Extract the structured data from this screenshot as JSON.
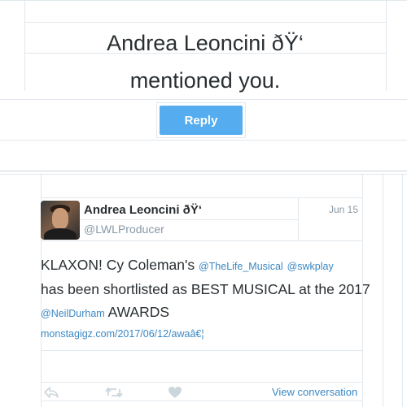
{
  "notification": {
    "line1": "Andrea Leoncini ðŸ‘",
    "line2": "mentioned you.",
    "reply_label": "Reply"
  },
  "tweet": {
    "author_name": "Andrea Leoncini ðŸ‘",
    "author_handle": "@LWLProducer",
    "date": "Jun 15",
    "text_1": "KLAXON! Cy Coleman's ",
    "mention_1": "@TheLife_Musical",
    "mention_2": "@swkplay",
    "text_2": "has been shortlisted as BEST MUSICAL at the 2017 ",
    "mention_3": "@NeilDurham",
    "text_3": " AWARDS",
    "link": "monstagigz.com/2017/06/12/awaâ€¦",
    "view_conversation": "View conversation"
  },
  "icons": {
    "reply": "reply-icon",
    "retweet": "retweet-icon",
    "like": "heart-icon"
  },
  "colors": {
    "reply_button": "#55acee",
    "link": "#3b88c3",
    "muted": "#8899a6",
    "border": "#e1e8ed"
  }
}
